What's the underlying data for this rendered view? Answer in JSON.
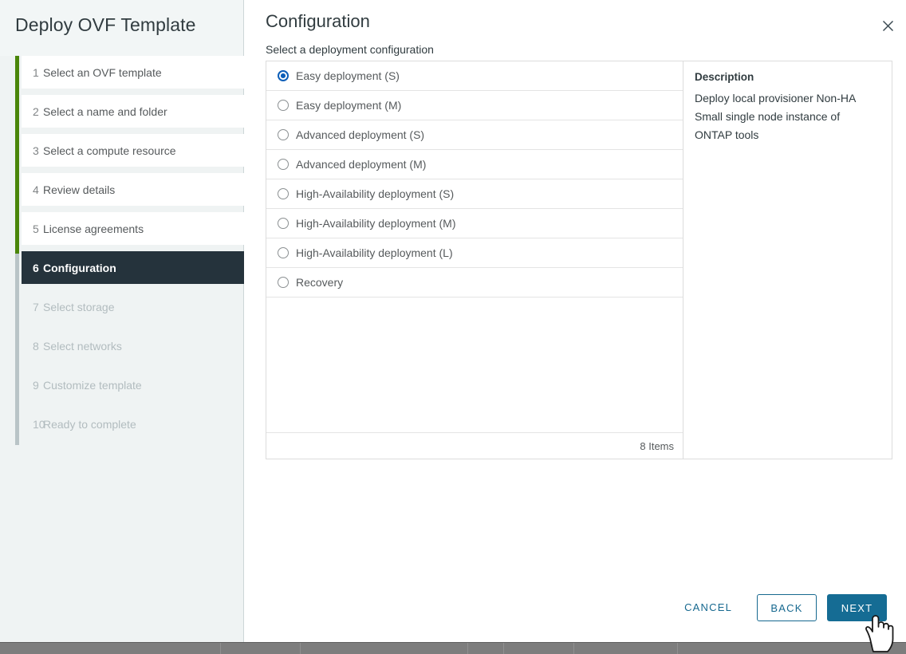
{
  "wizard": {
    "title": "Deploy OVF Template",
    "close_icon": "close-icon"
  },
  "sidebar": {
    "steps": [
      {
        "num": "1",
        "label": "Select an OVF template",
        "state": "done"
      },
      {
        "num": "2",
        "label": "Select a name and folder",
        "state": "done"
      },
      {
        "num": "3",
        "label": "Select a compute resource",
        "state": "done"
      },
      {
        "num": "4",
        "label": "Review details",
        "state": "done"
      },
      {
        "num": "5",
        "label": "License agreements",
        "state": "done"
      },
      {
        "num": "6",
        "label": "Configuration",
        "state": "active"
      },
      {
        "num": "7",
        "label": "Select storage",
        "state": "pending"
      },
      {
        "num": "8",
        "label": "Select networks",
        "state": "pending"
      },
      {
        "num": "9",
        "label": "Customize template",
        "state": "pending"
      },
      {
        "num": "10",
        "label": "Ready to complete",
        "state": "pending"
      }
    ]
  },
  "page": {
    "title": "Configuration",
    "section_label": "Select a deployment configuration"
  },
  "config_list": {
    "options": [
      {
        "label": "Easy deployment (S)",
        "selected": true
      },
      {
        "label": "Easy deployment (M)",
        "selected": false
      },
      {
        "label": "Advanced deployment (S)",
        "selected": false
      },
      {
        "label": "Advanced deployment (M)",
        "selected": false
      },
      {
        "label": "High-Availability deployment (S)",
        "selected": false
      },
      {
        "label": "High-Availability deployment (M)",
        "selected": false
      },
      {
        "label": "High-Availability deployment (L)",
        "selected": false
      },
      {
        "label": "Recovery",
        "selected": false
      }
    ],
    "item_count_label": "8 Items"
  },
  "description": {
    "title": "Description",
    "lines": [
      "Deploy local provisioner Non-HA",
      "Small single node instance of",
      "ONTAP tools"
    ]
  },
  "footer": {
    "cancel_label": "CANCEL",
    "back_label": "BACK",
    "next_label": "NEXT"
  },
  "colors": {
    "progress_green": "#4a8609",
    "active_step_bg": "#25333c",
    "radio_blue": "#0c5eb8",
    "primary_button": "#156c94",
    "link_blue": "#16688f",
    "sidebar_bg": "#eff3f3"
  }
}
